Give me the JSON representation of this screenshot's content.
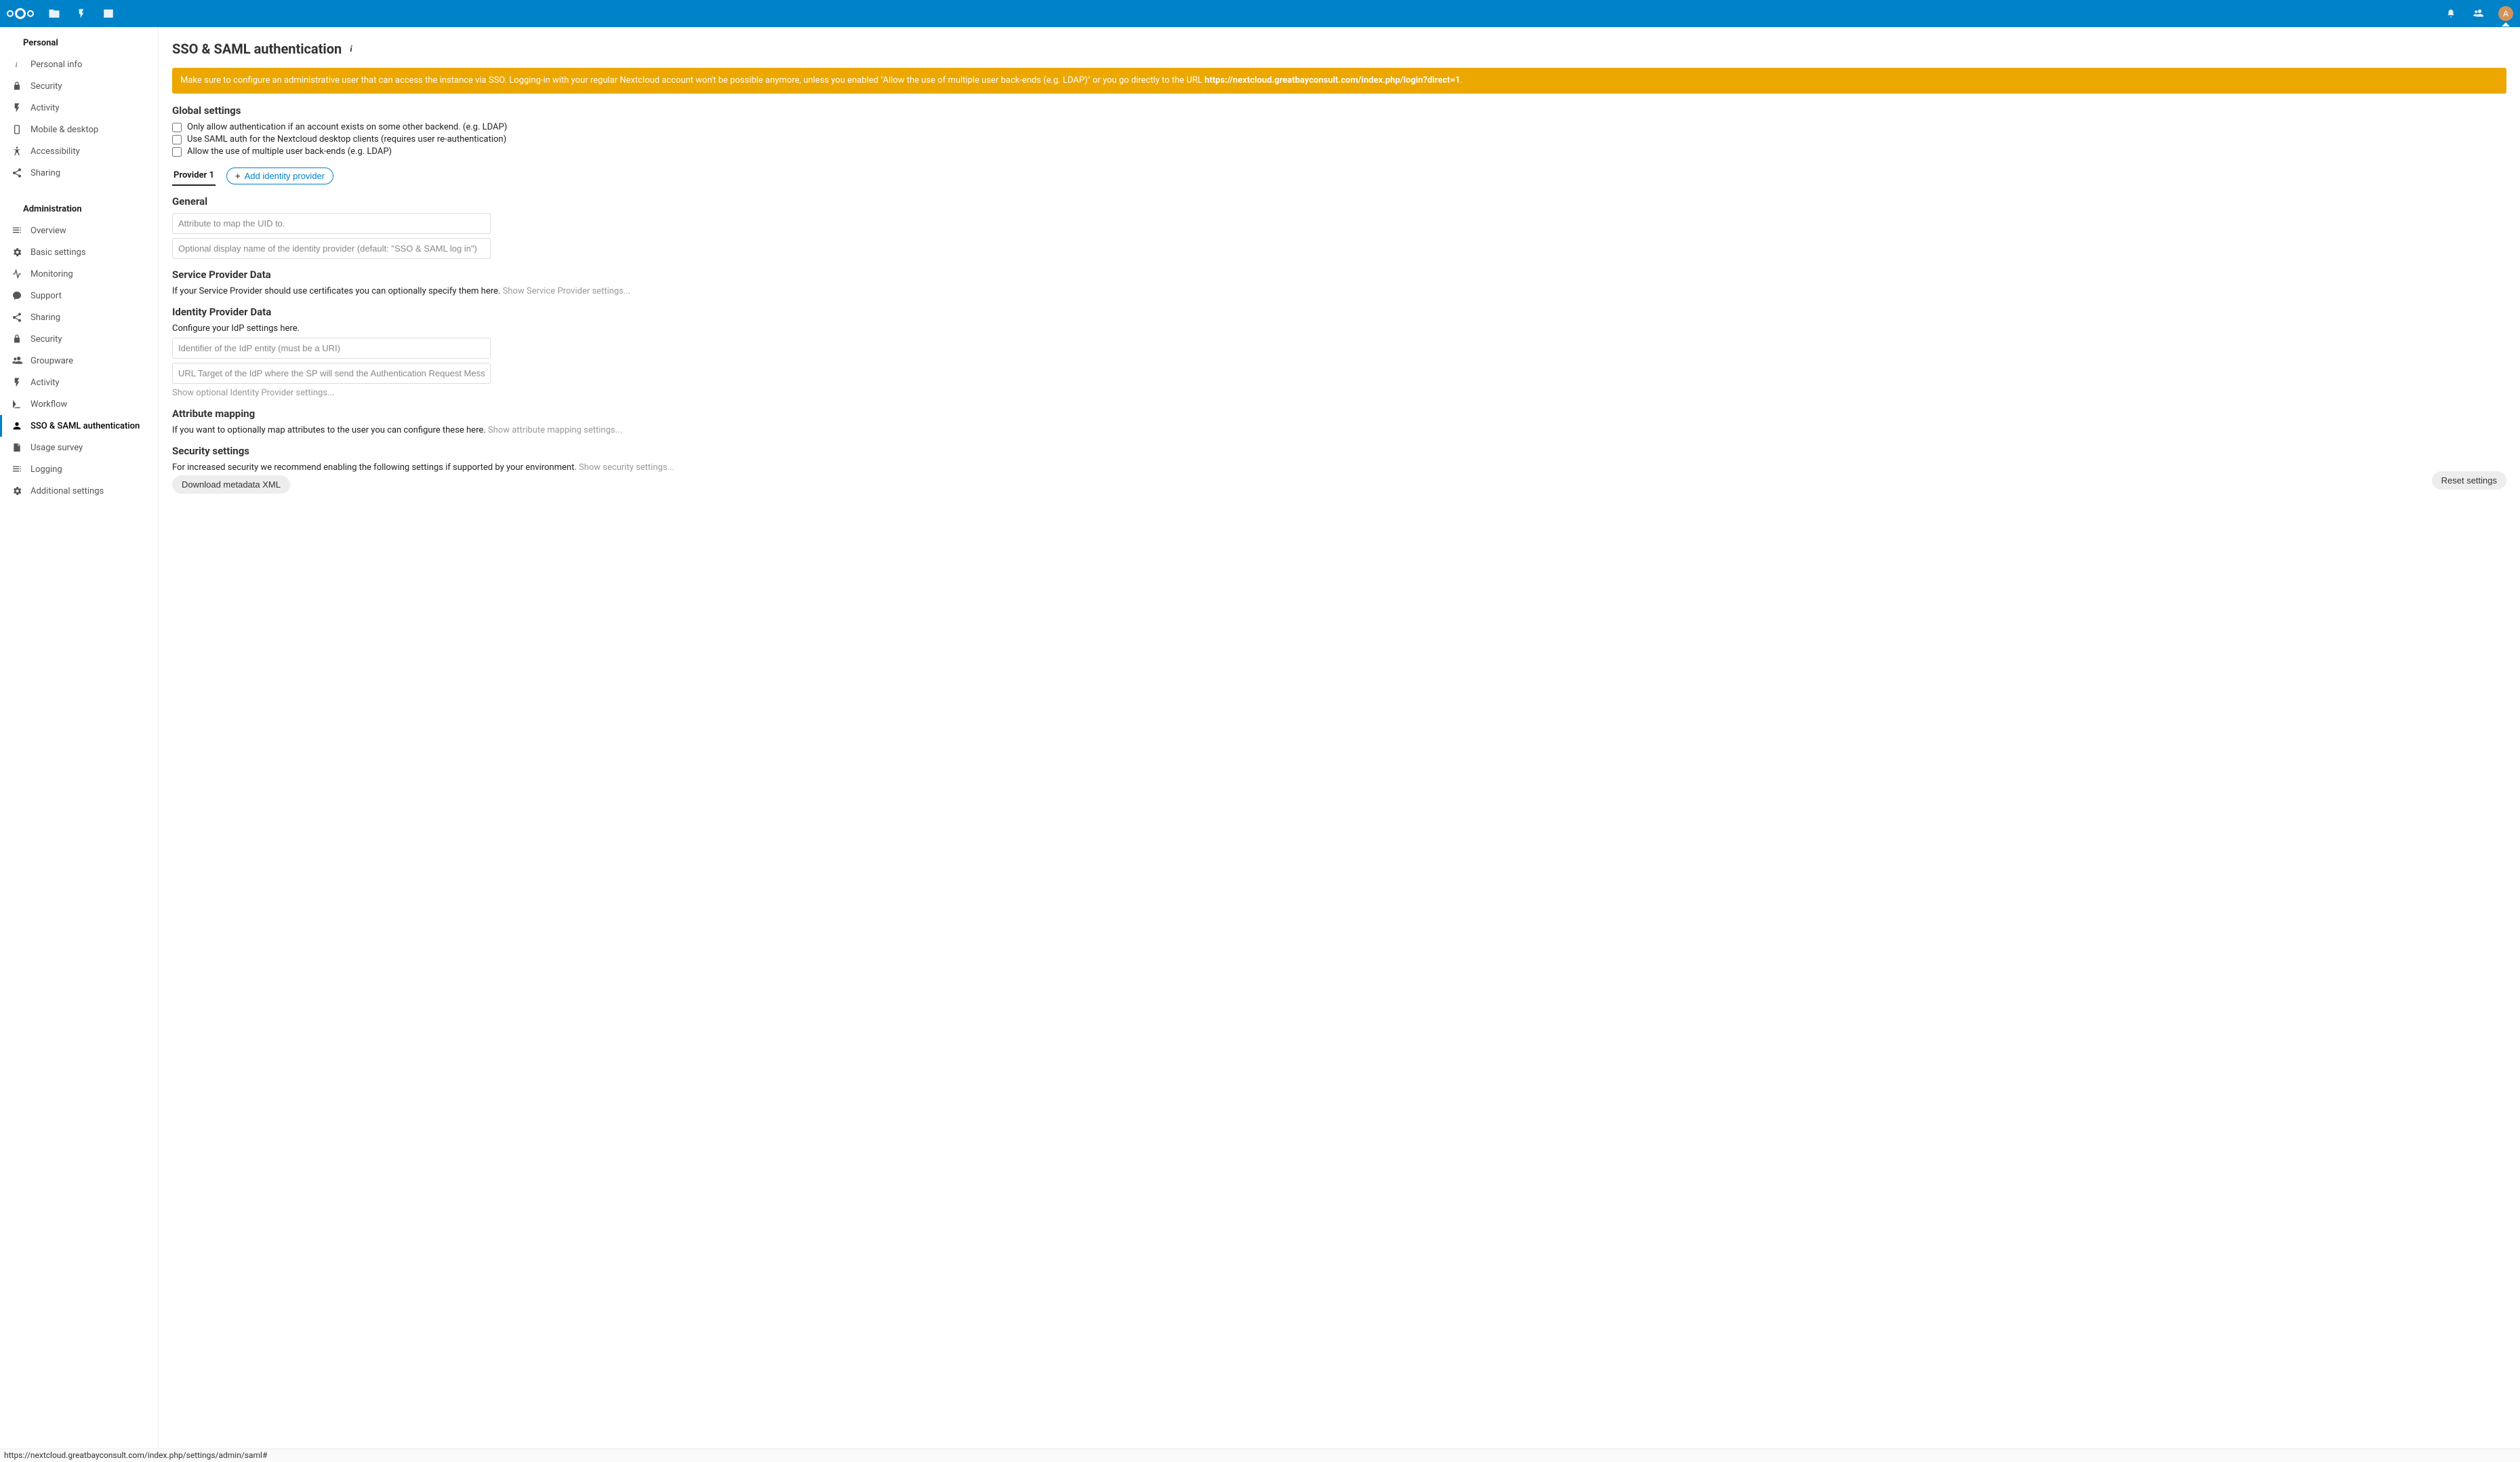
{
  "avatar_letter": "A",
  "page_title": "SSO & SAML authentication",
  "warning_text_pre": "Make sure to configure an administrative user that can access the instance via SSO. Logging-in with your regular Nextcloud account won't be possible anymore, unless you enabled \"Allow the use of multiple user back-ends (e.g. LDAP)\" or you go directly to the URL ",
  "warning_url": "https://nextcloud.greatbayconsult.com/index.php/login?direct=1",
  "warning_text_post": ".",
  "global_settings_title": "Global settings",
  "checks": [
    "Only allow authentication if an account exists on some other backend. (e.g. LDAP)",
    "Use SAML auth for the Nextcloud desktop clients (requires user re-authentication)",
    "Allow the use of multiple user back-ends (e.g. LDAP)"
  ],
  "tab1": "Provider 1",
  "add_provider": "Add identity provider",
  "general_title": "General",
  "uid_placeholder": "Attribute to map the UID to.",
  "displayname_placeholder": "Optional display name of the identity provider (default: \"SSO & SAML log in\")",
  "spd_title": "Service Provider Data",
  "spd_desc": "If your Service Provider should use certificates you can optionally specify them here.",
  "spd_link": "Show Service Provider settings...",
  "idp_title": "Identity Provider Data",
  "idp_desc": "Configure your IdP settings here.",
  "idp_id_placeholder": "Identifier of the IdP entity (must be a URI)",
  "idp_url_placeholder": "URL Target of the IdP where the SP will send the Authentication Request Message",
  "idp_link": "Show optional Identity Provider settings...",
  "attr_title": "Attribute mapping",
  "attr_desc": "If you want to optionally map attributes to the user you can configure these here.",
  "attr_link": "Show attribute mapping settings...",
  "sec_title": "Security settings",
  "sec_desc": "For increased security we recommend enabling the following settings if supported by your environment.",
  "sec_link": "Show security settings...",
  "download_btn": "Download metadata XML",
  "reset_btn": "Reset settings",
  "sidebar": {
    "personal_title": "Personal",
    "personal": [
      {
        "key": "personal-info",
        "label": "Personal info"
      },
      {
        "key": "security",
        "label": "Security"
      },
      {
        "key": "activity",
        "label": "Activity"
      },
      {
        "key": "mobile",
        "label": "Mobile & desktop"
      },
      {
        "key": "accessibility",
        "label": "Accessibility"
      },
      {
        "key": "sharing",
        "label": "Sharing"
      }
    ],
    "admin_title": "Administration",
    "admin": [
      {
        "key": "overview",
        "label": "Overview"
      },
      {
        "key": "basic",
        "label": "Basic settings"
      },
      {
        "key": "monitoring",
        "label": "Monitoring"
      },
      {
        "key": "support",
        "label": "Support"
      },
      {
        "key": "sharing-admin",
        "label": "Sharing"
      },
      {
        "key": "security-admin",
        "label": "Security"
      },
      {
        "key": "groupware",
        "label": "Groupware"
      },
      {
        "key": "activity-admin",
        "label": "Activity"
      },
      {
        "key": "workflow",
        "label": "Workflow"
      },
      {
        "key": "saml",
        "label": "SSO & SAML authentication",
        "active": true
      },
      {
        "key": "usage",
        "label": "Usage survey"
      },
      {
        "key": "logging",
        "label": "Logging"
      },
      {
        "key": "additional",
        "label": "Additional settings"
      }
    ]
  },
  "status_url": "https://nextcloud.greatbayconsult.com/index.php/settings/admin/saml#"
}
